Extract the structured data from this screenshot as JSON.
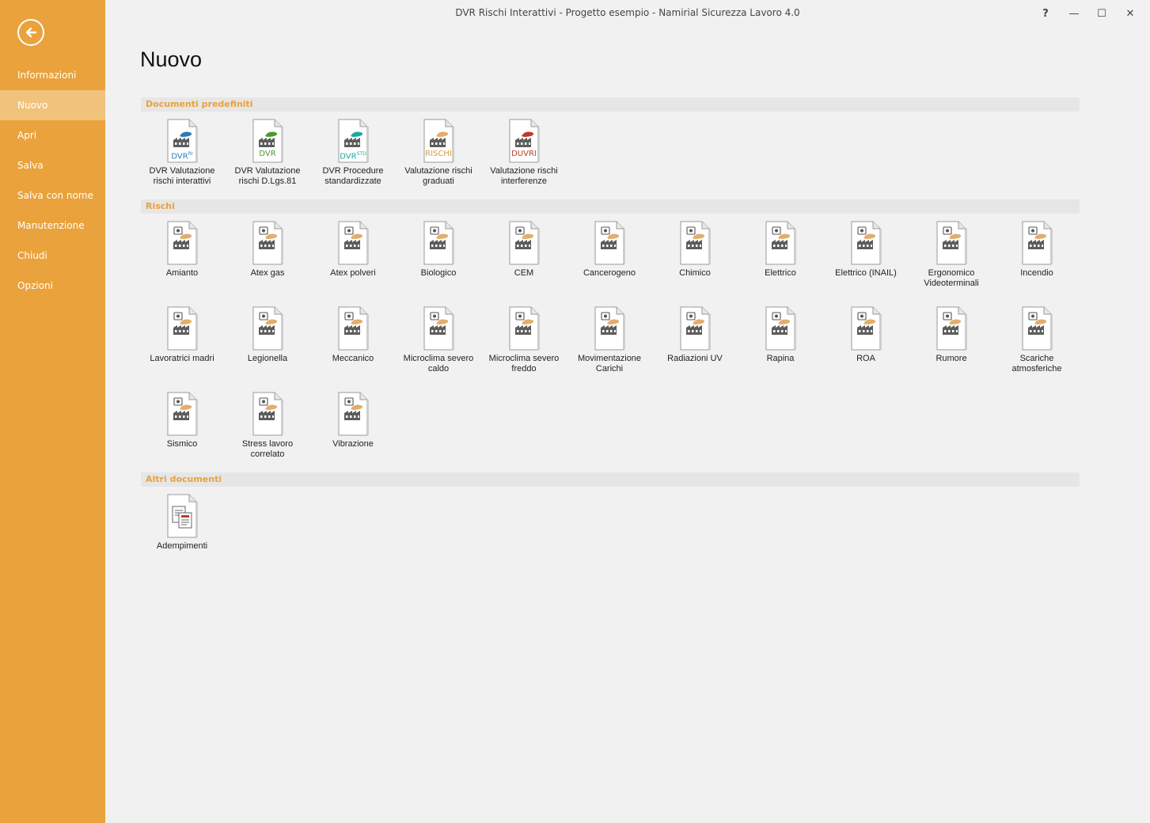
{
  "window": {
    "title": "DVR Rischi Interattivi - Progetto esempio - Namirial Sicurezza Lavoro 4.0",
    "help": "?",
    "minimize": "—",
    "maximize": "☐",
    "close": "✕"
  },
  "sidebar": {
    "items": [
      {
        "label": "Informazioni"
      },
      {
        "label": "Nuovo"
      },
      {
        "label": "Apri"
      },
      {
        "label": "Salva"
      },
      {
        "label": "Salva con nome"
      },
      {
        "label": "Manutenzione"
      },
      {
        "label": "Chiudi"
      },
      {
        "label": "Opzioni"
      }
    ],
    "active": "Nuovo"
  },
  "page": {
    "title": "Nuovo"
  },
  "sections": {
    "predefiniti": {
      "title": "Documenti predefiniti",
      "items": [
        {
          "label": "DVR Valutazione rischi interattivi",
          "tag": "DVR",
          "sup": "RI",
          "tag_color": "#2b7bb9",
          "blob_color": "#2b7bb9",
          "icon": "factory-document-icon"
        },
        {
          "label": "DVR Valutazione rischi D.Lgs.81",
          "tag": "DVR",
          "sup": "",
          "tag_color": "#4c9a2a",
          "blob_color": "#4c9a2a",
          "icon": "factory-document-icon"
        },
        {
          "label": "DVR Procedure standardizzate",
          "tag": "DVR",
          "sup": "STD",
          "tag_color": "#1ea7a0",
          "blob_color": "#1ea7a0",
          "icon": "factory-document-icon"
        },
        {
          "label": "Valutazione rischi graduati",
          "tag": "RISCHI",
          "sup": "",
          "tag_color": "#d99a3a",
          "blob_color": "#e3ad6a",
          "icon": "factory-document-icon"
        },
        {
          "label": "Valutazione rischi interferenze",
          "tag": "DUVRI",
          "sup": "",
          "tag_color": "#c0392b",
          "blob_color": "#c0392b",
          "icon": "factory-document-icon"
        }
      ]
    },
    "rischi": {
      "title": "Rischi",
      "items": [
        {
          "label": "Amianto",
          "icon": "asbestos-icon"
        },
        {
          "label": "Atex gas",
          "icon": "gas-cylinder-icon"
        },
        {
          "label": "Atex polveri",
          "icon": "dust-icon"
        },
        {
          "label": "Biologico",
          "icon": "biohazard-worker-icon"
        },
        {
          "label": "CEM",
          "icon": "electromagnetic-warning-icon"
        },
        {
          "label": "Cancerogeno",
          "icon": "carcinogen-icon"
        },
        {
          "label": "Chimico",
          "icon": "skull-icon"
        },
        {
          "label": "Elettrico",
          "icon": "lightning-icon"
        },
        {
          "label": "Elettrico (INAIL)",
          "icon": "lightning-icon"
        },
        {
          "label": "Ergonomico Videoterminali",
          "icon": "monitor-icon"
        },
        {
          "label": "Incendio",
          "icon": "fire-warning-icon"
        },
        {
          "label": "Lavoratrici madri",
          "icon": "pregnant-icon"
        },
        {
          "label": "Legionella",
          "icon": "bacteria-icon"
        },
        {
          "label": "Meccanico",
          "icon": "gear-icon"
        },
        {
          "label": "Microclima severo caldo",
          "icon": "thermometer-icon"
        },
        {
          "label": "Microclima severo freddo",
          "icon": "snowflake-icon"
        },
        {
          "label": "Movimentazione Carichi",
          "icon": "lifting-icon"
        },
        {
          "label": "Radiazioni UV",
          "icon": "uv-icon"
        },
        {
          "label": "Rapina",
          "icon": "robber-icon"
        },
        {
          "label": "ROA",
          "icon": "laser-icon"
        },
        {
          "label": "Rumore",
          "icon": "ear-icon"
        },
        {
          "label": "Scariche atmosferiche",
          "icon": "storm-icon"
        },
        {
          "label": "Sismico",
          "icon": "earthquake-icon"
        },
        {
          "label": "Stress lavoro correlato",
          "icon": "brain-icon"
        },
        {
          "label": "Vibrazione",
          "icon": "vibration-warning-icon"
        }
      ]
    },
    "altri": {
      "title": "Altri documenti",
      "items": [
        {
          "label": "Adempimenti",
          "icon": "documents-icon"
        }
      ]
    }
  },
  "colors": {
    "accent": "#e9a23c",
    "accent_light": "#f1c27c",
    "background": "#f1f1f1",
    "section_bg": "#e6e6e6",
    "factory_blob": "#e3ad6a"
  }
}
